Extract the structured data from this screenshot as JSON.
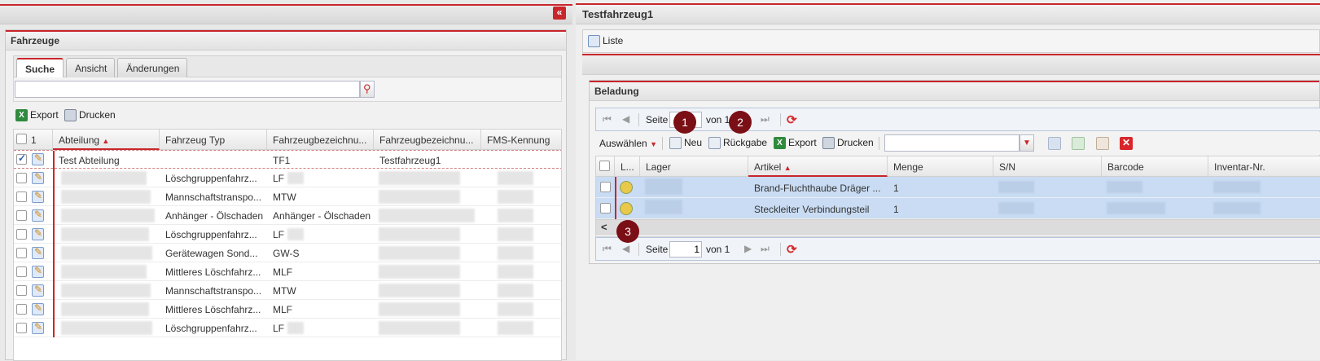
{
  "left": {
    "collapse_glyph": "«",
    "panel_title": "Fahrzeuge",
    "tabs": [
      "Suche",
      "Ansicht",
      "Änderungen"
    ],
    "search": {
      "value": "",
      "placeholder": ""
    },
    "toolbar": {
      "export": "Export",
      "print": "Drucken"
    },
    "grid": {
      "select_count": "1",
      "columns": [
        "Abteilung",
        "Fahrzeug Typ",
        "Fahrzeugbezeichnu...",
        "Fahrzeugbezeichnu...",
        "FMS-Kennung"
      ],
      "rows": [
        {
          "abteilung": "Test Abteilung",
          "typ": "",
          "bez1": "TF1",
          "bez2": "Testfahrzeug1",
          "checked": true
        },
        {
          "abteilung": "",
          "typ": "Löschgruppenfahrz...",
          "bez1": "LF",
          "bez2": ""
        },
        {
          "abteilung": "",
          "typ": "Mannschaftstranspo...",
          "bez1": "MTW",
          "bez2": ""
        },
        {
          "abteilung": "",
          "typ": "Anhänger - Ölschaden",
          "bez1": "Anhänger - Ölschaden",
          "bez2": ""
        },
        {
          "abteilung": "",
          "typ": "Löschgruppenfahrz...",
          "bez1": "LF",
          "bez2": ""
        },
        {
          "abteilung": "",
          "typ": "Gerätewagen Sond...",
          "bez1": "GW-S",
          "bez2": ""
        },
        {
          "abteilung": "",
          "typ": "Mittleres Löschfahrz...",
          "bez1": "MLF",
          "bez2": ""
        },
        {
          "abteilung": "",
          "typ": "Mannschaftstranspo...",
          "bez1": "MTW",
          "bez2": ""
        },
        {
          "abteilung": "",
          "typ": "Mittleres Löschfahrz...",
          "bez1": "MLF",
          "bez2": ""
        },
        {
          "abteilung": "",
          "typ": "Löschgruppenfahrz...",
          "bez1": "LF",
          "bez2": ""
        }
      ]
    }
  },
  "right": {
    "window_title": "Testfahrzeug1",
    "liste_label": "Liste",
    "beladung_title": "Beladung",
    "pager_top": {
      "seite": "Seite",
      "page": "",
      "von": "von 1"
    },
    "pager_bottom": {
      "seite": "Seite",
      "page": "1",
      "von": "von 1"
    },
    "badges": [
      "1",
      "2",
      "3"
    ],
    "toolbar": {
      "auswaehlen": "Auswählen",
      "neu": "Neu",
      "rueckgabe": "Rückgabe",
      "export": "Export",
      "print": "Drucken",
      "combo_value": ""
    },
    "grid": {
      "columns": [
        "L...",
        "Lager",
        "Artikel",
        "Menge",
        "S/N",
        "Barcode",
        "Inventar-Nr."
      ],
      "rows": [
        {
          "artikel": "Brand-Fluchthaube Dräger ...",
          "menge": "1"
        },
        {
          "artikel": "Steckleiter Verbindungsteil",
          "menge": "1"
        }
      ]
    },
    "scroll_left_glyph": "<"
  },
  "colors": {
    "accent_red": "#c9262b",
    "badge": "#7a0f15",
    "selected_row": "#c9dcf3"
  }
}
